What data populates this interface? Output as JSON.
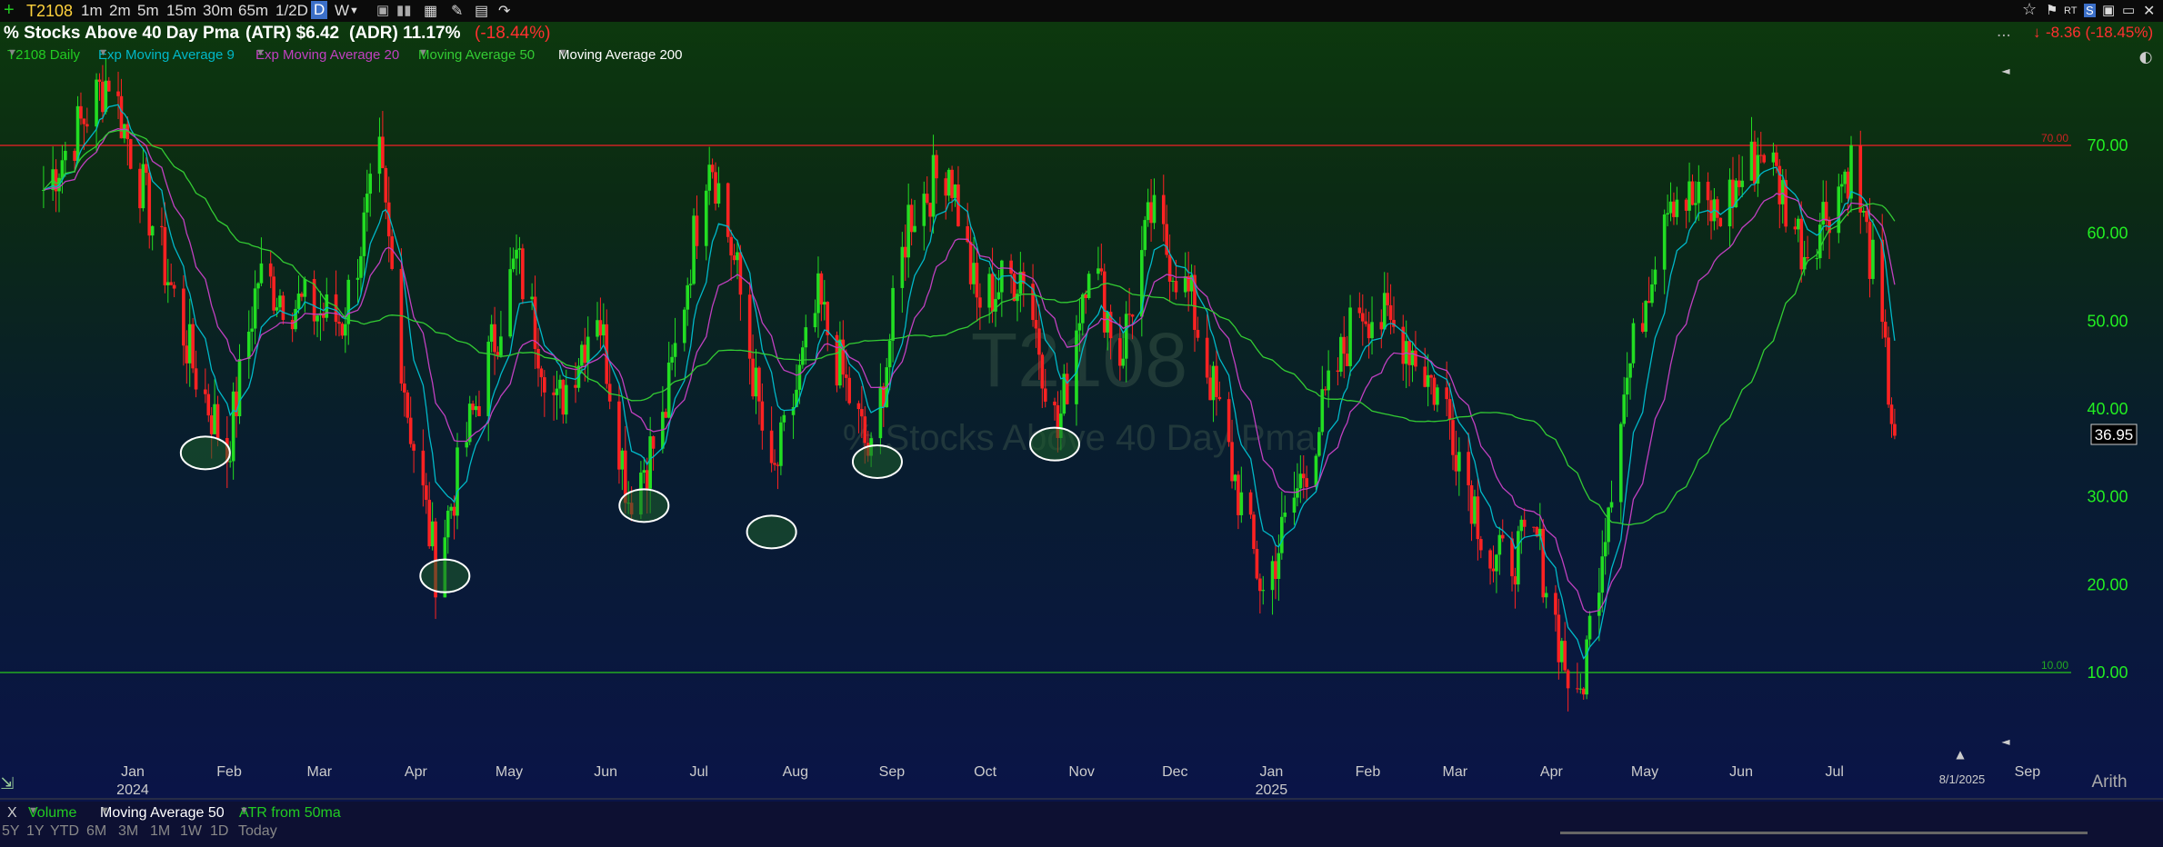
{
  "toolbar": {
    "symbol": "T2108",
    "timeframes": [
      "1m",
      "2m",
      "5m",
      "15m",
      "30m",
      "65m",
      "1/2D",
      "D",
      "W"
    ],
    "active_timeframe": "D"
  },
  "header": {
    "title": "% Stocks Above 40 Day Pma",
    "atr": "(ATR) $6.42",
    "adr": "(ADR) 11.17%",
    "change": "(-18.44%)",
    "right_change": "-8.36 (-18.45%)",
    "ellipsis": "...",
    "colors": {
      "up": "#22dd22",
      "down": "#ff2222",
      "cyan": "#00c8d8",
      "magenta": "#c040c0"
    }
  },
  "studies": [
    {
      "label": "T2108 Daily",
      "color": "#22cc22"
    },
    {
      "label": "Exp Moving Average 9",
      "color": "#00b8c8"
    },
    {
      "label": "Exp Moving Average 20",
      "color": "#c040c0"
    },
    {
      "label": "Moving Average 50",
      "color": "#33cc33"
    },
    {
      "label": "Moving Average 200",
      "color": "#ffffff"
    }
  ],
  "watermark": {
    "symbol": "T2108",
    "name": "% Stocks Above 40 Day Pma"
  },
  "axis": {
    "y_ticks": [
      "70.00",
      "60.00",
      "50.00",
      "40.00",
      "30.00",
      "20.00",
      "10.00"
    ],
    "y_values": [
      70,
      60,
      50,
      40,
      30,
      20,
      10
    ],
    "last_price": "36.95",
    "months": [
      "Jan",
      "Feb",
      "Mar",
      "Apr",
      "May",
      "Jun",
      "Jul",
      "Aug",
      "Sep",
      "Oct",
      "Nov",
      "Dec",
      "Jan",
      "Feb",
      "Mar",
      "Apr",
      "May",
      "Jun",
      "Jul",
      "Sep"
    ],
    "years": [
      "2024",
      "2025"
    ],
    "current_date": "8/1/2025",
    "scale": "Arith"
  },
  "chart_data": {
    "type": "line",
    "series_name": "T2108 Daily",
    "x": [
      "2023-12-15",
      "2024-01-05",
      "2024-01-20",
      "2024-02-01",
      "2024-02-12",
      "2024-02-22",
      "2024-03-05",
      "2024-03-20",
      "2024-04-01",
      "2024-04-10",
      "2024-04-19",
      "2024-04-30",
      "2024-05-15",
      "2024-05-28",
      "2024-06-10",
      "2024-06-20",
      "2024-07-01",
      "2024-07-16",
      "2024-07-25",
      "2024-08-05",
      "2024-08-20",
      "2024-09-06",
      "2024-09-18",
      "2024-10-01",
      "2024-10-10",
      "2024-10-25",
      "2024-11-05",
      "2024-11-15",
      "2024-11-25",
      "2024-12-05",
      "2024-12-18",
      "2025-01-10",
      "2025-01-24",
      "2025-02-10",
      "2025-02-25",
      "2025-03-10",
      "2025-03-25",
      "2025-04-08",
      "2025-04-21",
      "2025-05-05",
      "2025-05-20",
      "2025-06-05",
      "2025-06-20",
      "2025-07-03",
      "2025-07-18",
      "2025-07-25",
      "2025-08-01"
    ],
    "values": [
      65,
      78,
      60,
      45,
      35,
      55,
      52,
      50,
      68,
      40,
      22,
      38,
      57,
      40,
      52,
      30,
      38,
      70,
      55,
      31,
      52,
      34,
      62,
      68,
      52,
      56,
      37,
      58,
      46,
      62,
      52,
      19,
      34,
      52,
      48,
      40,
      22,
      25,
      5,
      40,
      65,
      62,
      70,
      58,
      68,
      56,
      36.95
    ],
    "reference_lines": [
      {
        "label": "70.00",
        "value": 70,
        "color": "#cc2222"
      },
      {
        "label": "10.00",
        "value": 10,
        "color": "#22aa22"
      }
    ],
    "highlighted_lows": [
      {
        "date": "2024-02-05",
        "value": 35
      },
      {
        "date": "2024-04-22",
        "value": 21
      },
      {
        "date": "2024-06-25",
        "value": 29
      },
      {
        "date": "2024-08-05",
        "value": 26
      },
      {
        "date": "2024-09-08",
        "value": 34
      },
      {
        "date": "2024-11-04",
        "value": 36
      }
    ],
    "ylim": [
      0,
      80
    ],
    "grid": false
  },
  "bottombar": {
    "close_label": "X",
    "studies": [
      "Volume",
      "Moving Average 50",
      "ATR from 50ma"
    ],
    "ranges": [
      "5Y",
      "1Y",
      "YTD",
      "6M",
      "3M",
      "1M",
      "1W",
      "1D",
      "Today"
    ]
  }
}
